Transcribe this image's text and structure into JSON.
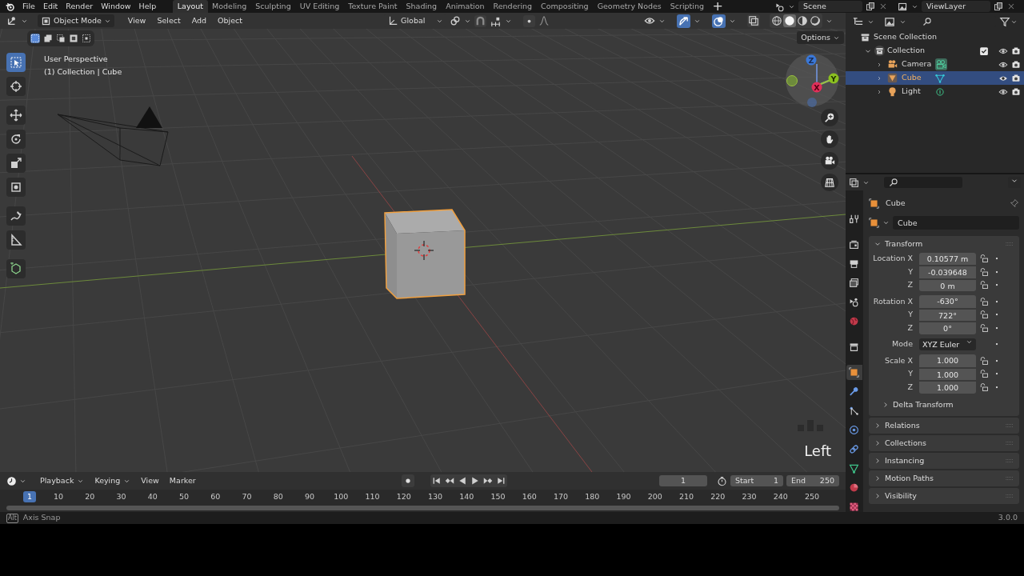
{
  "menu_bar": {
    "menus": [
      "File",
      "Edit",
      "Render",
      "Window",
      "Help"
    ],
    "workspaces": [
      {
        "label": "Layout",
        "selected": true
      },
      {
        "label": "Modeling",
        "selected": false
      },
      {
        "label": "Sculpting",
        "selected": false
      },
      {
        "label": "UV Editing",
        "selected": false
      },
      {
        "label": "Texture Paint",
        "selected": false
      },
      {
        "label": "Shading",
        "selected": false
      },
      {
        "label": "Animation",
        "selected": false
      },
      {
        "label": "Rendering",
        "selected": false
      },
      {
        "label": "Compositing",
        "selected": false
      },
      {
        "label": "Geometry Nodes",
        "selected": false
      },
      {
        "label": "Scripting",
        "selected": false
      }
    ],
    "add_tab": "+",
    "scene": "Scene",
    "view_layer": "ViewLayer"
  },
  "viewport": {
    "mode": "Object Mode",
    "menus": [
      "View",
      "Select",
      "Add",
      "Object"
    ],
    "orientation": "Global",
    "options": "Options",
    "gizmos_on": true,
    "overlays_on": true,
    "xray_on": false,
    "shading": [
      {
        "kind": "wireframe",
        "selected": false
      },
      {
        "kind": "solid",
        "selected": true
      },
      {
        "kind": "material",
        "selected": false
      },
      {
        "kind": "rendered",
        "selected": false
      }
    ],
    "select_modes": [
      {
        "kind": "set",
        "selected": true
      },
      {
        "kind": "extend",
        "selected": false
      },
      {
        "kind": "subtract",
        "selected": false
      },
      {
        "kind": "invert",
        "selected": false
      },
      {
        "kind": "intersect",
        "selected": false
      }
    ],
    "tools": [
      {
        "kind": "select",
        "selected": true
      },
      {
        "kind": "cursor",
        "selected": false
      },
      {
        "kind": "move",
        "selected": false
      },
      {
        "kind": "rotate",
        "selected": false
      },
      {
        "kind": "scale",
        "selected": false
      },
      {
        "kind": "transform",
        "selected": false
      },
      {
        "kind": "annotate",
        "selected": false
      },
      {
        "kind": "measure",
        "selected": false
      },
      {
        "kind": "add-cube",
        "selected": false
      }
    ],
    "overlay_text": [
      "User Perspective",
      "(1) Collection | Cube"
    ],
    "gizmo_axes": [
      "Z",
      "Y",
      "X"
    ],
    "view_name": "Left"
  },
  "outliner": {
    "root": "Scene Collection",
    "collections": [
      {
        "label": "Collection",
        "expanded": true,
        "checked": true,
        "children": [
          {
            "label": "Camera",
            "kind": "camera",
            "selected": false
          },
          {
            "label": "Cube",
            "kind": "mesh",
            "selected": true
          },
          {
            "label": "Light",
            "kind": "light",
            "selected": false
          }
        ]
      }
    ]
  },
  "properties": {
    "tabs": [
      {
        "kind": "tool",
        "selected": false
      },
      {
        "kind": "render",
        "selected": false
      },
      {
        "kind": "output",
        "selected": false
      },
      {
        "kind": "view-layer",
        "selected": false
      },
      {
        "kind": "scene",
        "selected": false
      },
      {
        "kind": "world",
        "selected": false
      },
      {
        "kind": "collection",
        "selected": false
      },
      {
        "kind": "object",
        "selected": true
      },
      {
        "kind": "modifiers",
        "selected": false
      },
      {
        "kind": "particles",
        "selected": false
      },
      {
        "kind": "physics",
        "selected": false
      },
      {
        "kind": "constraints",
        "selected": false
      },
      {
        "kind": "data",
        "selected": false
      },
      {
        "kind": "material",
        "selected": false
      },
      {
        "kind": "texture",
        "selected": false
      }
    ],
    "object_name": "Cube",
    "name_field": "Cube",
    "transform": {
      "title": "Transform",
      "expanded": true,
      "groups": [
        [
          {
            "label": "Location X",
            "value": "0.10577 m",
            "kind": "number"
          },
          {
            "label": "Y",
            "value": "-0.039648",
            "kind": "number"
          },
          {
            "label": "Z",
            "value": "0 m",
            "kind": "number"
          }
        ],
        [
          {
            "label": "Rotation X",
            "value": "-630°",
            "kind": "number"
          },
          {
            "label": "Y",
            "value": "722°",
            "kind": "number"
          },
          {
            "label": "Z",
            "value": "0°",
            "kind": "number"
          }
        ],
        [
          {
            "label": "Mode",
            "value": "XYZ Euler",
            "kind": "dropdown"
          }
        ],
        [
          {
            "label": "Scale X",
            "value": "1.000",
            "kind": "number"
          },
          {
            "label": "Y",
            "value": "1.000",
            "kind": "number"
          },
          {
            "label": "Z",
            "value": "1.000",
            "kind": "number"
          }
        ]
      ],
      "subpanel": {
        "title": "Delta Transform",
        "expanded": false
      }
    },
    "panels": [
      {
        "title": "Relations",
        "expanded": false
      },
      {
        "title": "Collections",
        "expanded": false
      },
      {
        "title": "Instancing",
        "expanded": false
      },
      {
        "title": "Motion Paths",
        "expanded": false
      },
      {
        "title": "Visibility",
        "expanded": false
      }
    ]
  },
  "timeline": {
    "menus": [
      "Playback",
      "Keying",
      "View",
      "Marker"
    ],
    "current_frame": "1",
    "start_label": "Start",
    "start": "1",
    "end_label": "End",
    "end": "250",
    "playhead": "1",
    "ticks": [
      "10",
      "20",
      "30",
      "40",
      "50",
      "60",
      "70",
      "80",
      "90",
      "100",
      "110",
      "120",
      "130",
      "140",
      "150",
      "160",
      "170",
      "180",
      "190",
      "200",
      "210",
      "220",
      "230",
      "240",
      "250"
    ]
  },
  "status_bar": {
    "key": "Alt",
    "hint": "Axis Snap",
    "version": "3.0.0"
  }
}
